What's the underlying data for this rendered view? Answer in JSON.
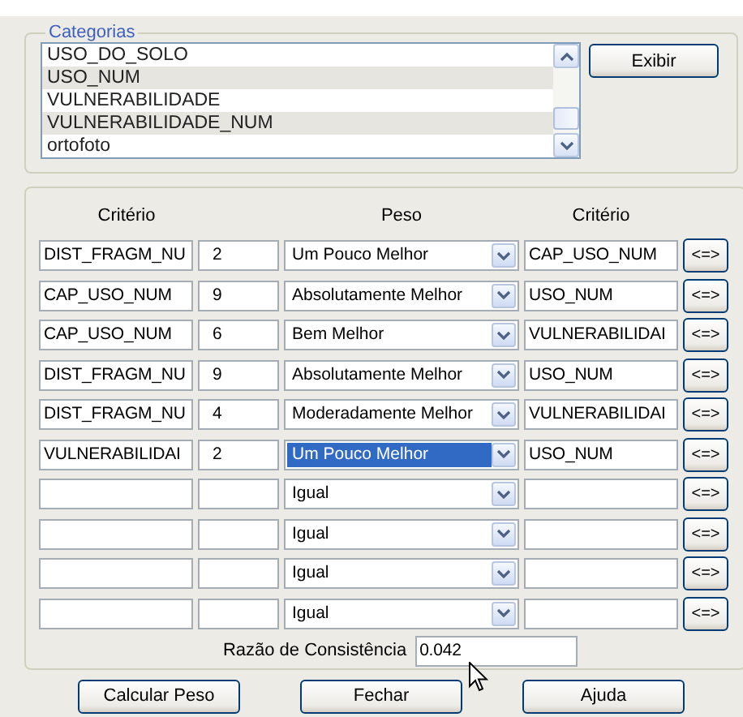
{
  "categories": {
    "label": "Categorias",
    "items": [
      {
        "text": "USO_DO_SOLO",
        "selected": false
      },
      {
        "text": "USO_NUM",
        "selected": true
      },
      {
        "text": "VULNERABILIDADE",
        "selected": false
      },
      {
        "text": "VULNERABILIDADE_NUM",
        "selected": true
      },
      {
        "text": "ortofoto",
        "selected": false
      }
    ],
    "button": "Exibir"
  },
  "comparisons": {
    "headers": [
      "Critério",
      "Peso",
      "Critério"
    ],
    "rows": [
      {
        "criterion_a": "DIST_FRAGM_NU",
        "weight": "2",
        "intensity": "Um Pouco Melhor",
        "criterion_b": "CAP_USO_NUM",
        "highlighted": false,
        "swap": "<=>"
      },
      {
        "criterion_a": "CAP_USO_NUM",
        "weight": "9",
        "intensity": "Absolutamente Melhor",
        "criterion_b": "USO_NUM",
        "highlighted": false,
        "swap": "<=>"
      },
      {
        "criterion_a": "CAP_USO_NUM",
        "weight": "6",
        "intensity": "Bem Melhor",
        "criterion_b": "VULNERABILIDAI",
        "highlighted": false,
        "swap": "<=>"
      },
      {
        "criterion_a": "DIST_FRAGM_NU",
        "weight": "9",
        "intensity": "Absolutamente Melhor",
        "criterion_b": "USO_NUM",
        "highlighted": false,
        "swap": "<=>"
      },
      {
        "criterion_a": "DIST_FRAGM_NU",
        "weight": "4",
        "intensity": "Moderadamente Melhor",
        "criterion_b": "VULNERABILIDAI",
        "highlighted": false,
        "swap": "<=>"
      },
      {
        "criterion_a": "VULNERABILIDAI",
        "weight": "2",
        "intensity": "Um Pouco Melhor",
        "criterion_b": "USO_NUM",
        "highlighted": true,
        "swap": "<=>"
      },
      {
        "intensity": "Igual",
        "highlighted": false,
        "swap": "<=>"
      },
      {
        "intensity": "Igual",
        "highlighted": false,
        "swap": "<=>"
      },
      {
        "intensity": "Igual",
        "highlighted": false,
        "swap": "<=>"
      },
      {
        "intensity": "Igual",
        "highlighted": false,
        "swap": "<=>"
      }
    ],
    "consistency": {
      "label": "Razão de Consistência",
      "value": "0.042"
    }
  },
  "buttons": [
    "Calcular Peso",
    "Fechar",
    "Ajuda"
  ]
}
